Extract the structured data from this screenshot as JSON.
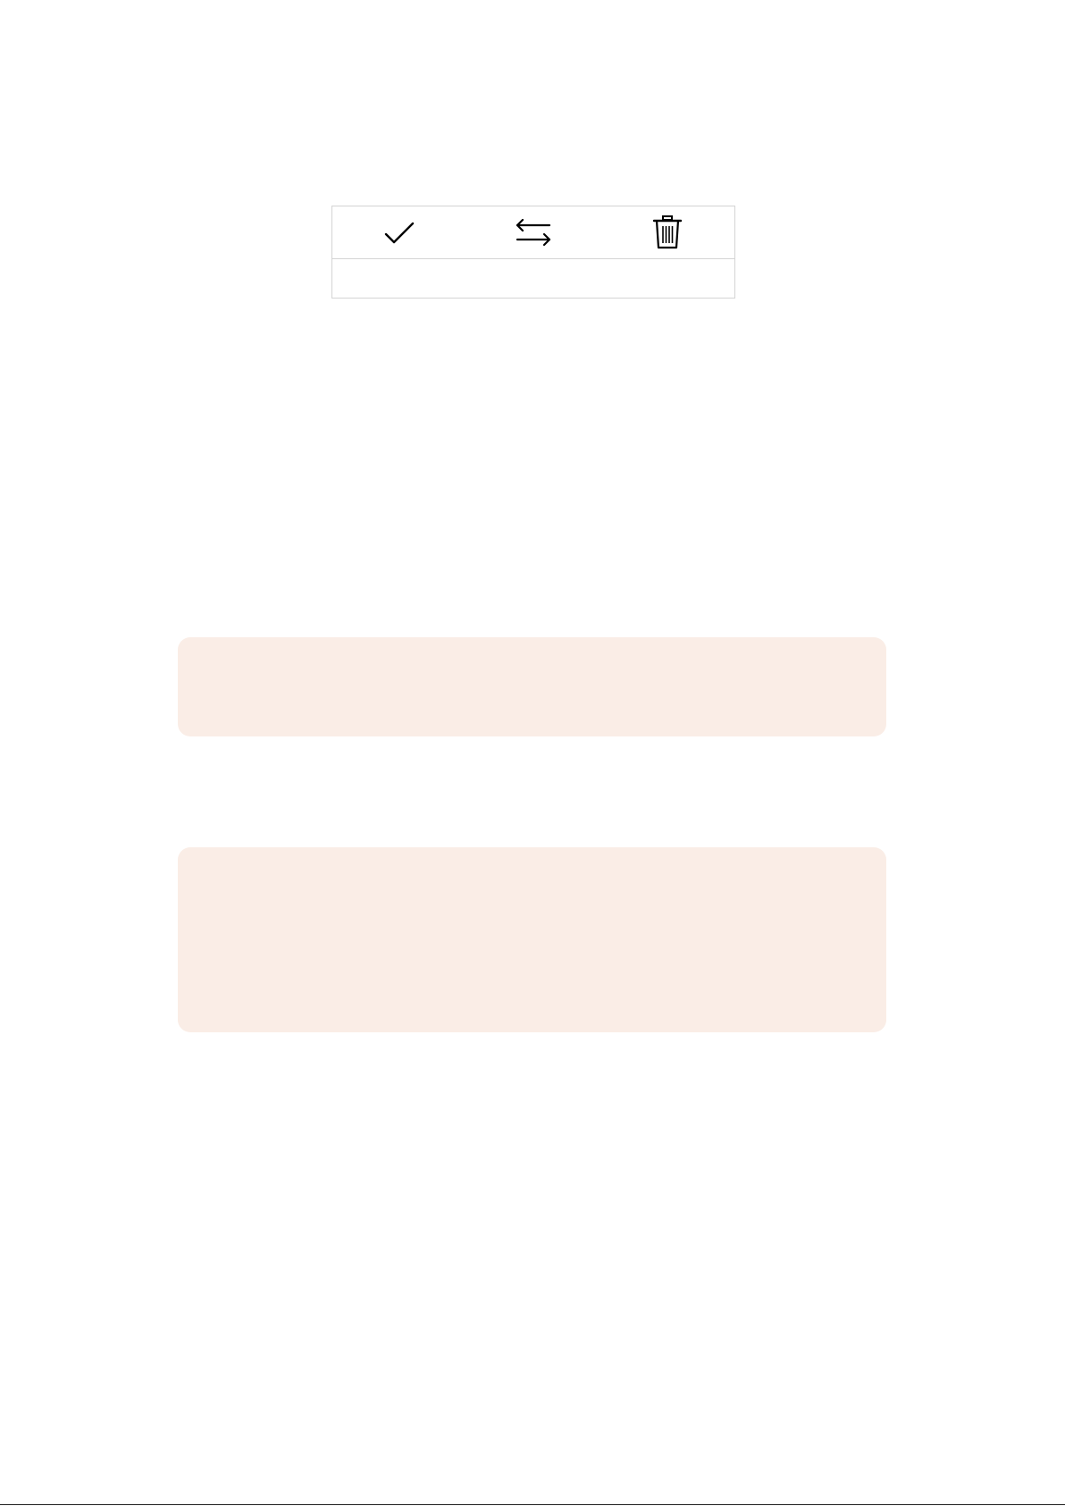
{
  "action_table": {
    "icons": [
      {
        "name": "checkmark-icon",
        "label": ""
      },
      {
        "name": "swap-arrows-icon",
        "label": ""
      },
      {
        "name": "trash-icon",
        "label": ""
      }
    ]
  },
  "callouts": [
    {
      "text": "",
      "background": "#faede6"
    },
    {
      "text": "",
      "background": "#faede6"
    }
  ],
  "colors": {
    "border": "#d4d4d4",
    "callout_background": "#faede6",
    "icon": "#000000"
  }
}
